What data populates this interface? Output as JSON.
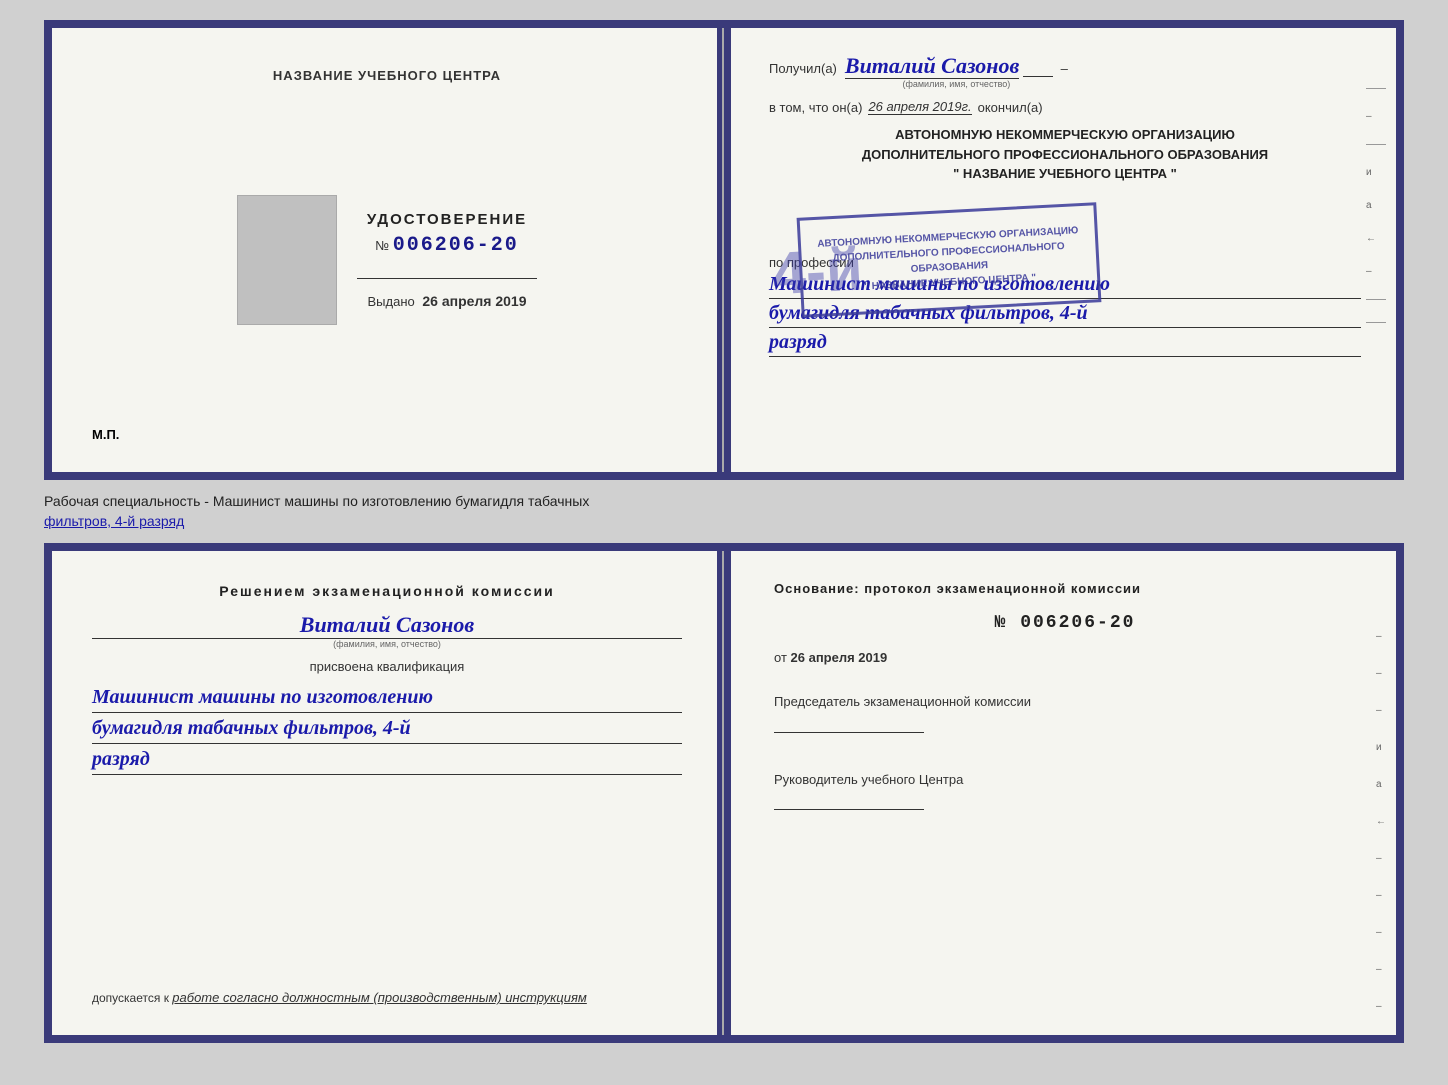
{
  "topDocument": {
    "leftPage": {
      "institutionName": "НАЗВАНИЕ УЧЕБНОГО ЦЕНТРА",
      "photoAlt": "photo placeholder",
      "certLabel": "УДОСТОВЕРЕНИЕ",
      "certNumberPrefix": "№",
      "certNumber": "006206-20",
      "issuedLabel": "Выдано",
      "issuedDate": "26 апреля 2019",
      "mpLabel": "М.П."
    },
    "rightPage": {
      "receivedLabel": "Получил(а)",
      "recipientName": "Виталий Сазонов",
      "recipientSubtitle": "(фамилия, имя, отчество)",
      "inThatLabel": "в том, что он(а)",
      "completedDate": "26 апреля 2019г.",
      "completedLabel": "окончил(а)",
      "orgLine1": "АВТОНОМНУЮ НЕКОММЕРЧЕСКУЮ ОРГАНИЗАЦИЮ",
      "orgLine2": "ДОПОЛНИТЕЛЬНОГО ПРОФЕССИОНАЛЬНОГО ОБРАЗОВАНИЯ",
      "orgLine3": "\" НАЗВАНИЕ УЧЕБНОГО ЦЕНТРА \"",
      "professionLabel": "по профессии",
      "professionValue1": "Машинист машины по изготовлению",
      "professionValue2": "бумагидля табачных фильтров, 4-й",
      "professionValue3": "разряд",
      "stampText": "АВТОНОМНУЮ НЕКОММЕРЧЕСКУЮ ОРГАНИЗАЦИЮ ДОПОЛНИТЕЛЬНОГО ПРОФЕССИОНАЛЬНОГО ОБРАЗОВАНИЯ \" НАЗВАНИЕ УЧЕБНОГО ЦЕНТРА \"",
      "stampNumber": "4-й"
    }
  },
  "betweenDocs": {
    "text1": "Рабочая специальность - Машинист машины по изготовлению бумагидля табачных",
    "text2underlined": "фильтров, 4-й разряд"
  },
  "bottomDocument": {
    "leftPage": {
      "decisionTitle": "Решением  экзаменационной  комиссии",
      "personName": "Виталий Сазонов",
      "personSubtitle": "(фамилия, имя, отчество)",
      "assignedText": "присвоена квалификация",
      "qualValue1": "Машинист машины по изготовлению",
      "qualValue2": "бумагидля табачных фильтров, 4-й",
      "qualValue3": "разряд",
      "admitLabel": "допускается к",
      "admitValue": "работе согласно должностным (производственным) инструкциям"
    },
    "rightPage": {
      "basisText": "Основание:  протокол  экзаменационной  комиссии",
      "protocolNumberPrefix": "№",
      "protocolNumber": "006206-20",
      "protocolDatePrefix": "от",
      "protocolDate": "26 апреля 2019",
      "chairmanTitle": "Председатель экзаменационной комиссии",
      "headTitle": "Руководитель учебного Центра"
    }
  },
  "decoItems": {
    "dashes": [
      "–",
      "–",
      "–",
      "и",
      "а",
      "←",
      "–",
      "–",
      "–",
      "–",
      "–"
    ]
  }
}
